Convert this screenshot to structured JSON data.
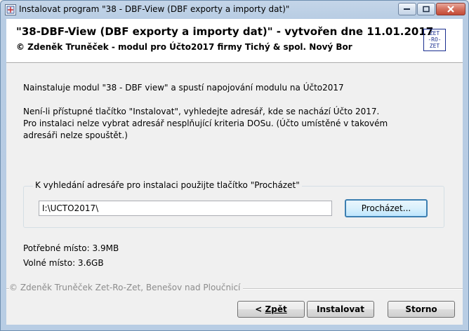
{
  "window": {
    "title": "Instalovat program \"38 - DBF-View (DBF exporty a importy dat)\""
  },
  "header": {
    "title": "\"38-DBF-View (DBF exporty a importy dat)\" - vytvořen dne 11.01.2017",
    "subtitle": "© Zdeněk Truněček - modul pro Účto2017 firmy Tichý & spol. Nový Bor",
    "logo_lines": [
      "ZET",
      "-RO-",
      "ZET"
    ]
  },
  "body": {
    "intro": "Nainstaluje modul \"38 - DBF view\" a spustí napojování modulu na Účto2017",
    "note_lines": [
      "Není-li přístupné tlačítko \"Instalovat\", vyhledejte adresář, kde se nachází Účto  2017.",
      "Pro instalaci nelze vybrat adresář nesplňující kriteria DOSu. (Účto umístěné v takovém",
      "adresáři nelze spouštět.)"
    ]
  },
  "folder_group": {
    "label": "K vyhledání adresáře pro instalaci použijte tlačítko \"Procházet\"",
    "path_value": "I:\\UCTO2017\\",
    "browse_label": "Procházet..."
  },
  "space": {
    "required": "Potřebné místo: 3.9MB",
    "free": "Volné místo: 3.6GB"
  },
  "footer": {
    "copyright": "© Zdeněk Truněček Zet-Ro-Zet, Benešov nad Ploučnicí"
  },
  "buttons": {
    "back_arrow": "<",
    "back_label": "Zpět",
    "install_label": "Instalovat",
    "cancel_label": "Storno"
  }
}
